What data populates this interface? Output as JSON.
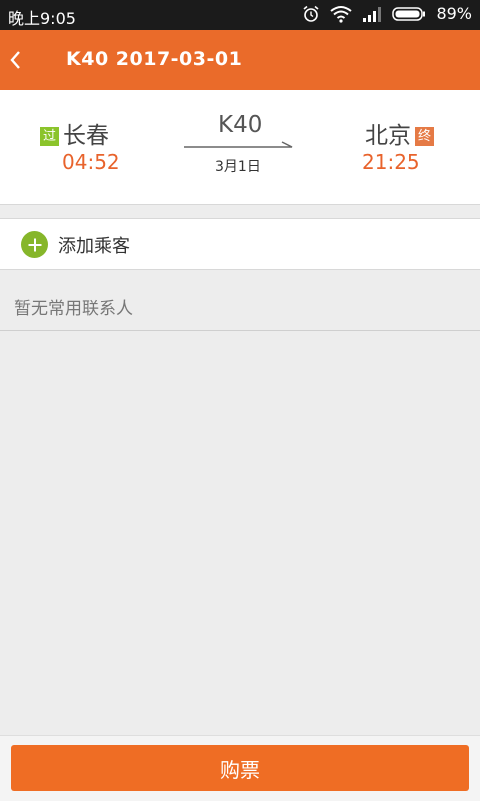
{
  "status_bar": {
    "time": "晚上9:05",
    "battery": "89%",
    "icons": [
      "alarm-icon",
      "wifi-icon",
      "signal-icon",
      "battery-icon"
    ]
  },
  "header": {
    "title": "K40  2017-03-01",
    "back_icon": "chevron-left-icon"
  },
  "train": {
    "number": "K40",
    "date": "3月1日",
    "from": {
      "tag": "过",
      "name": "长春",
      "time": "04:52"
    },
    "to": {
      "tag": "终",
      "name": "北京",
      "time": "21:25"
    }
  },
  "passenger": {
    "add_label": "添加乘客",
    "empty_text": "暂无常用联系人"
  },
  "buy_button": "购票",
  "colors": {
    "header": "#ea6b2a",
    "accent_orange": "#e8632c",
    "pass_tag": "#8bc42b",
    "end_tag": "#e57a45",
    "add_icon": "#86b62a",
    "button": "#ef6d24"
  }
}
